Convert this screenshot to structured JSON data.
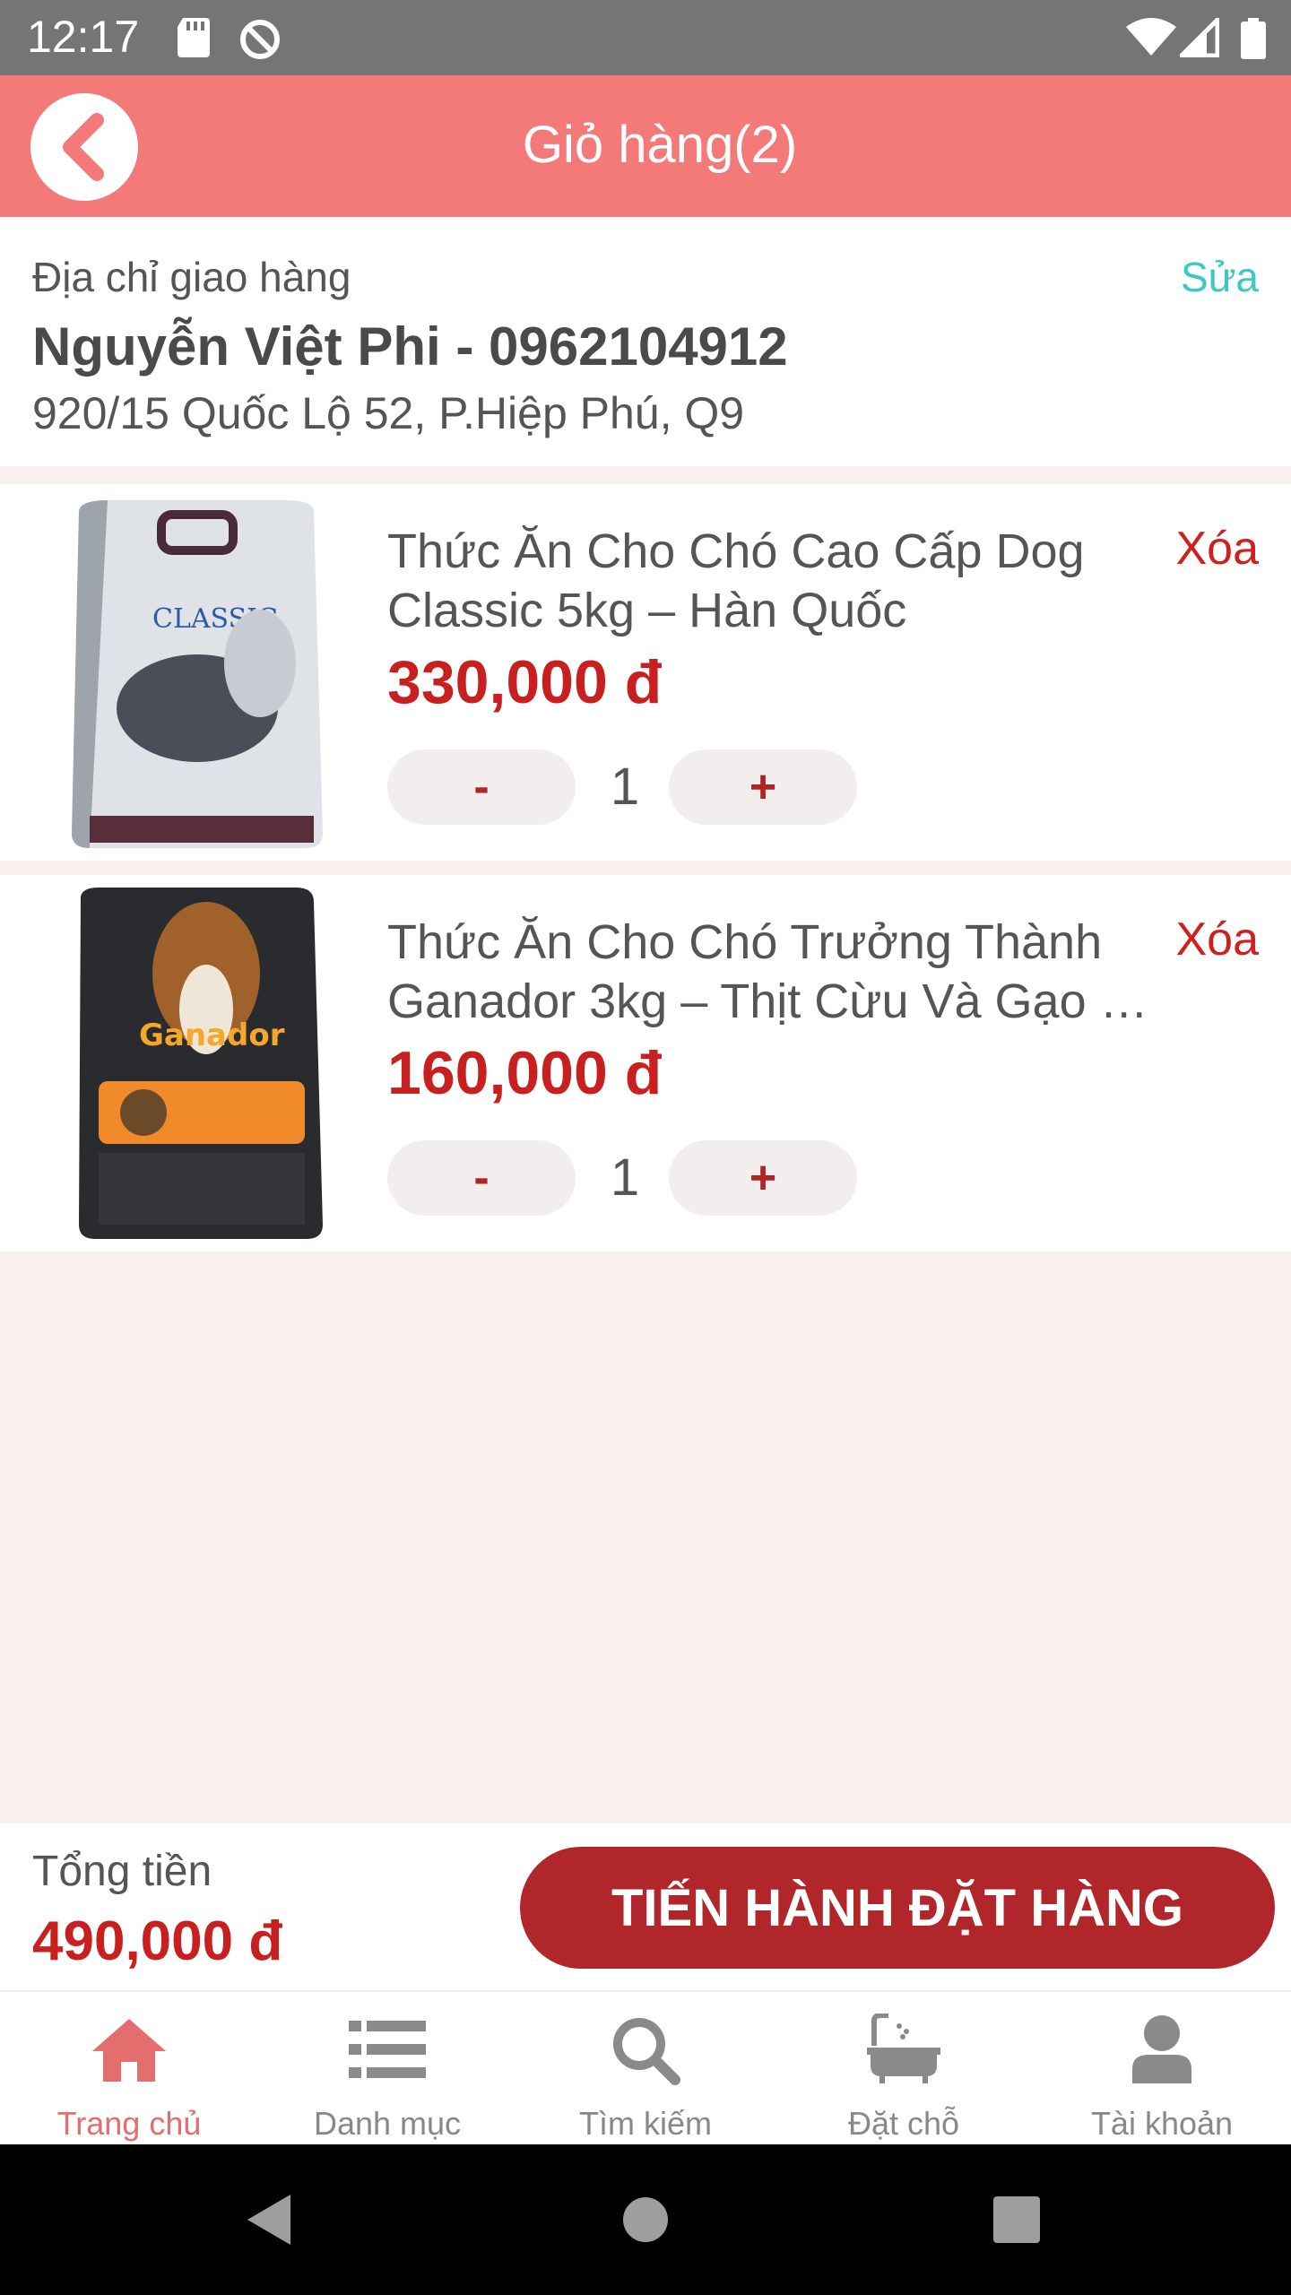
{
  "status_bar": {
    "time": "12:17"
  },
  "header": {
    "title": "Giỏ hàng(2)"
  },
  "address": {
    "label": "Địa chỉ giao hàng",
    "edit_label": "Sửa",
    "name_phone": "Nguyễn Việt Phi - 0962104912",
    "line": "920/15 Quốc Lộ 52, P.Hiệp Phú, Q9"
  },
  "items": [
    {
      "name_line1": "Thức Ăn Cho Chó Cao Cấp Dog",
      "name_line2": "Classic 5kg – Hàn Quốc",
      "price": "330,000 đ",
      "delete_label": "Xóa",
      "minus_label": "-",
      "plus_label": "+",
      "quantity": "1"
    },
    {
      "name_line1": "Thức Ăn Cho Chó Trưởng Thành",
      "name_line2": "Ganador 3kg – Thịt Cừu Và Gạo …",
      "price": "160,000 đ",
      "delete_label": "Xóa",
      "minus_label": "-",
      "plus_label": "+",
      "quantity": "1"
    }
  ],
  "summary": {
    "total_label": "Tổng tiền",
    "total_value": "490,000 đ",
    "checkout_label": "TIẾN HÀNH ĐẶT HÀNG"
  },
  "bottom_nav": [
    {
      "label": "Trang chủ",
      "icon": "home-icon",
      "active": true
    },
    {
      "label": "Danh mục",
      "icon": "list-icon",
      "active": false
    },
    {
      "label": "Tìm kiếm",
      "icon": "search-icon",
      "active": false
    },
    {
      "label": "Đặt chỗ",
      "icon": "bathtub-icon",
      "active": false
    },
    {
      "label": "Tài khoản",
      "icon": "user-icon",
      "active": false
    }
  ],
  "colors": {
    "header": "#f47a7a",
    "price": "#c81f1f",
    "checkout": "#b0262a",
    "edit_link": "#3dc9c3",
    "active_nav": "#e46d6d"
  }
}
